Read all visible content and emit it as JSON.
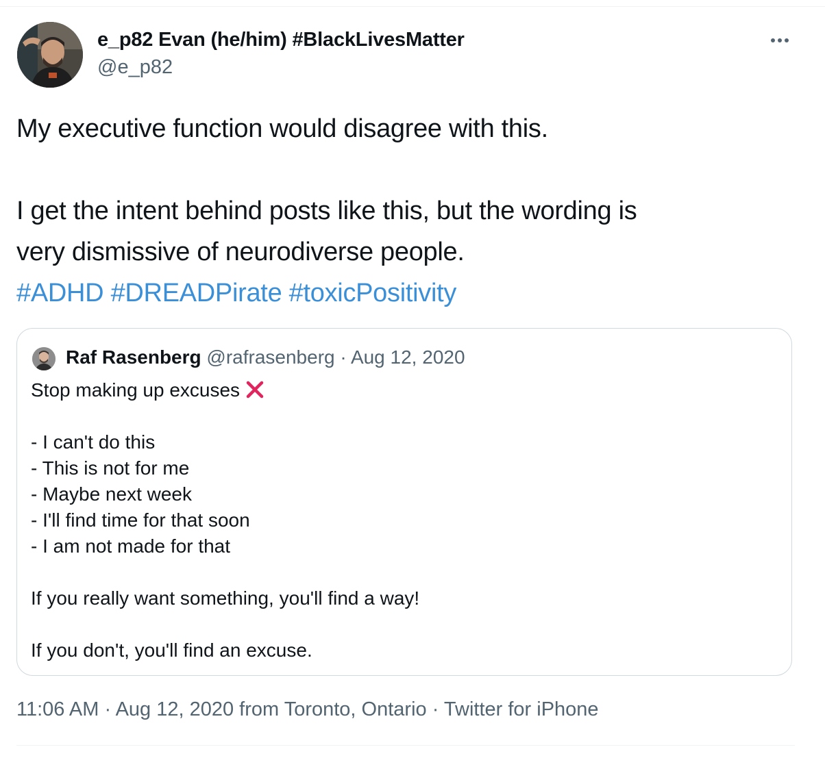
{
  "author": {
    "display_name": "e_p82 Evan (he/him) #BlackLivesMatter",
    "handle": "@e_p82"
  },
  "tweet": {
    "lines": [
      "My executive function would disagree with this.",
      "",
      "I get the intent behind posts like this, but the wording is",
      "very dismissive of neurodiverse people."
    ],
    "hashtags": [
      "#ADHD",
      "#DREADPirate",
      "#toxicPositivity"
    ]
  },
  "quoted_tweet": {
    "name": "Raf Rasenberg",
    "handle": "@rafrasenberg",
    "separator": " · ",
    "date": "Aug 12, 2020",
    "first_line": "Stop making up excuses",
    "x_icon": "cross-mark-icon",
    "list_items": [
      "- I can't do this",
      "- This is not for me",
      "- Maybe next week",
      "- I'll find time for that soon",
      "- I am not made for that"
    ],
    "closing_1": "If you really want something, you'll find a way!",
    "closing_2": "If you don't, you'll find an excuse."
  },
  "footer": {
    "time": "11:06 AM",
    "sep1": " · ",
    "date": "Aug 12, 2020",
    "location": " from Toronto, Ontario",
    "sep2": " · ",
    "source": "Twitter for iPhone"
  },
  "colors": {
    "link": "#3b8fd6",
    "muted": "#536471",
    "border": "#cfd9de",
    "cross": "#e0245e"
  },
  "icons": {
    "more": "more-horizontal-icon"
  }
}
